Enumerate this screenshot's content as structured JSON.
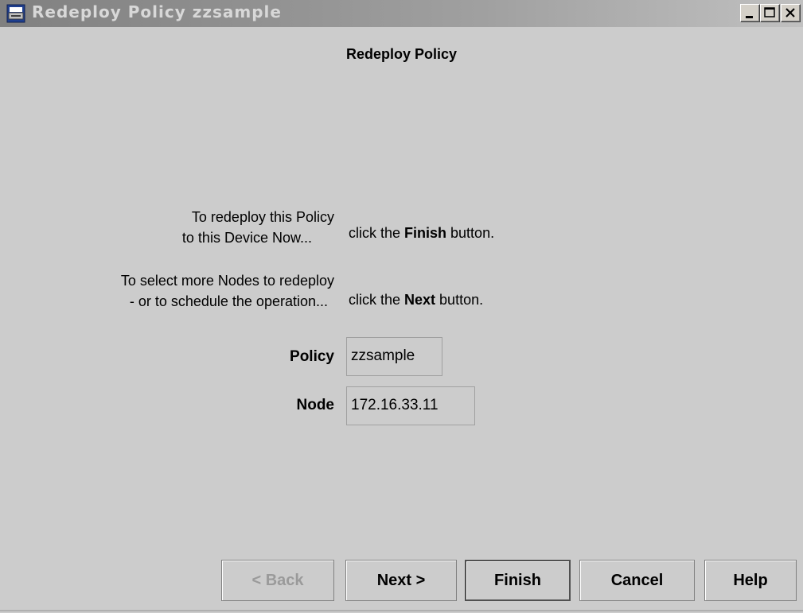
{
  "window": {
    "title": "Redeploy Policy zzsample",
    "minimize_icon": "minimize-icon",
    "maximize_icon": "maximize-icon",
    "close_icon": "close-icon",
    "app_icon": "printer-icon"
  },
  "dialog": {
    "heading": "Redeploy Policy",
    "finish_prompt": {
      "line1": "To redeploy this Policy",
      "line2": "to this Device Now...",
      "action_prefix": "click the ",
      "action_bold": "Finish",
      "action_suffix": " button."
    },
    "next_prompt": {
      "line1": "To select more Nodes to redeploy",
      "line2": "- or to schedule the operation...",
      "action_prefix": "click the ",
      "action_bold": "Next",
      "action_suffix": " button."
    },
    "fields": {
      "policy_label": "Policy",
      "policy_value": "zzsample",
      "node_label": "Node",
      "node_value": "172.16.33.11"
    }
  },
  "buttons": {
    "back": "< Back",
    "next": "Next >",
    "finish": "Finish",
    "cancel": "Cancel",
    "help": "Help"
  }
}
